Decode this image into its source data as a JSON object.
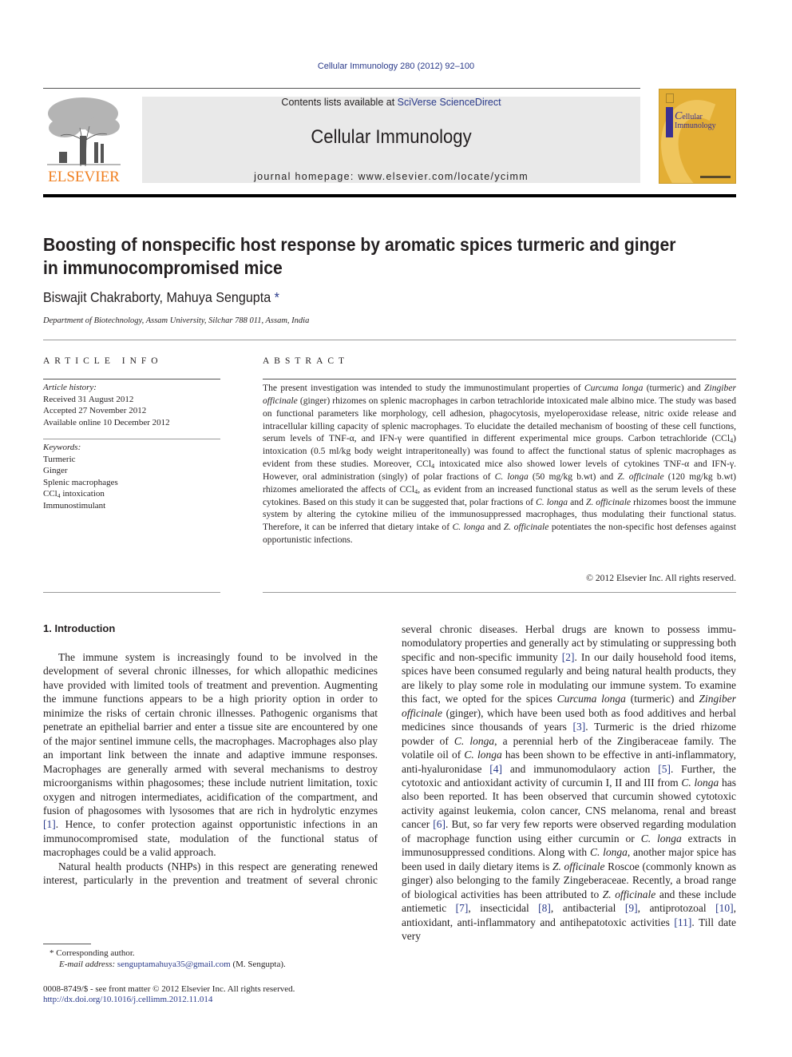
{
  "running_head": "Cellular Immunology 280 (2012) 92–100",
  "masthead": {
    "publisher_logo_text": "ELSEVIER",
    "contents_prefix": "Contents lists available at ",
    "contents_link": "SciVerse ScienceDirect",
    "journal_title": "Cellular Immunology",
    "homepage": "journal homepage: www.elsevier.com/locate/ycimm",
    "cover_title_line1": "ellular",
    "cover_title_line2": "Immunology",
    "cover_initial": "C"
  },
  "colors": {
    "link": "#2a3a8a",
    "elsevier_orange": "#f07f1f",
    "cover_gold": "#e3ae34",
    "banner_gray": "#e9e9e9"
  },
  "article": {
    "title_line1": "Boosting of nonspecific host response by aromatic spices turmeric and ginger",
    "title_line2": "in immunocompromised mice",
    "authors": "Biswajit Chakraborty, Mahuya Sengupta",
    "author_mark": "*",
    "affiliation": "Department of Biotechnology, Assam University, Silchar 788 011, Assam, India"
  },
  "article_info": {
    "heading": "ARTICLE INFO",
    "history_label": "Article history:",
    "history": [
      "Received 31 August 2012",
      "Accepted 27 November 2012",
      "Available online 10 December 2012"
    ],
    "keywords_label": "Keywords:",
    "keywords": [
      "Turmeric",
      "Ginger",
      "Splenic macrophages",
      "CCl4 intoxication",
      "Immunostimulant"
    ]
  },
  "abstract": {
    "heading": "ABSTRACT",
    "s1a": "The present investigation was intended to study the immunostimulant properties of ",
    "curcuma": "Curcuma longa",
    "s1b": " (turmeric) and ",
    "zingiber": "Zingiber officinale",
    "s1c": " (ginger) rhizomes on splenic macrophages in carbon tetrachloride intox­icated male albino mice. The study was based on functional parameters like morphology, cell adhesion, phagocytosis, myeloperoxidase release, nitric oxide release and intracellular killing capacity of splenic macrophages. To elucidate the detailed mechanism of boosting of these cell functions, serum levels of TNF-α, and IFN-γ were quantified in different experimental mice groups. Carbon tetrachloride (CCl",
    "s2": ") intoxication (0.5 ml/kg body weight intraperitoneally) was found to affect the functional status of splenic macrophages as evident from these studies. Moreover, CCl",
    "s3": " intoxicated mice also showed lower levels of cytokines TNF-α and IFN-γ. However, oral administration (singly) of polar fractions of ",
    "c_longa": "C. longa",
    "s4": " (50 mg/kg b.wt) and ",
    "z_off": "Z. officinale",
    "s5": " (120 mg/kg b.wt) rhizomes ameliorated the affects of CCl",
    "s6": ", as evident from an increased functional status as well as the serum levels of these cytokines. Based on this study it can be suggested that, polar fractions of ",
    "s7": " and ",
    "s8": " rhizomes boost the immune system by altering the cytokine milieu of the immunosuppressed macrophages, thus modulating their functional status. Therefore, it can be inferred that dietary intake of ",
    "s9": " potentiates the non-specific host defenses against opportunistic infections.",
    "sub4": "4",
    "copyright": "© 2012 Elsevier Inc. All rights reserved."
  },
  "introduction": {
    "heading": "1. Introduction",
    "p1a": "The immune system is increasingly found to be involved in the development of several chronic illnesses, for which allopathic medicines have provided with limited tools of treatment and pre­vention. Augmenting the immune functions appears to be a high priority option in order to minimize the risks of certain chronic ill­nesses. Pathogenic organisms that penetrate an epithelial barrier and enter a tissue site are encountered by one of the major sentinel immune cells, the macrophages. Macrophages also play an impor­tant link between the innate and adaptive immune responses. Macrophages are generally armed with several mechanisms to de­stroy microorganisms within phagosomes; these include nutrient limitation, toxic oxygen and nitrogen intermediates, acidification of the compartment, and fusion of phagosomes with lysosomes that are rich in hydrolytic enzymes ",
    "ref1": "[1]",
    "p1b": ". Hence, to confer protection against opportunistic infections in an immunocompromised state, modulation of the functional status of macrophages could be a va­lid approach.",
    "p2a": "Natural health products (NHPs) in this respect are generating renewed interest, particularly in the prevention and treatment of several chronic diseases. Herbal drugs are known to possess immu­nomodulatory properties and generally act by stimulating or sup­pressing both specific and non-specific immunity ",
    "ref2": "[2]",
    "p2b": ". In our daily household food items, spices have been consumed regularly and being natural health products, they are likely to play some role in modulating our immune system. To examine this fact, we opted for the spices ",
    "p2c": " (turmeric) and ",
    "p2d": " (gin­ger), which have been used both as food additives and herbal med­icines since thousands of years ",
    "ref3": "[3]",
    "p2e": ". Turmeric is the dried rhizome powder of ",
    "p2f": ", a perennial herb of the Zingiberaceae family. The volatile oil of ",
    "p2g": " has been shown to be effective in anti-inflammatory, anti-hyaluronidase ",
    "ref4": "[4]",
    "p2h": " and immunomodulaory ac­tion ",
    "ref5": "[5]",
    "p2i": ". Further, the cytotoxic and antioxidant activity of curcumin I, II and III from ",
    "p2j": " has also been reported. It has been ob­served that curcumin showed cytotoxic activity against leukemia, colon cancer, CNS melanoma, renal and breast cancer ",
    "ref6": "[6]",
    "p2k": ". But, so far very few reports were observed regarding modulation of mac­rophage function using either curcumin or ",
    "p2l": " extracts in immunosuppressed conditions. Along with ",
    "p2m": ", another major spice has been used in daily dietary items is ",
    "p2n": " Roscoe (commonly known as ginger) also belonging to the family Zinge­beraceae. Recently, a broad range of biological activities has been attributed to ",
    "p2o": " and these include antiemetic ",
    "ref7": "[7]",
    "p2p": ", insecti­cidal ",
    "ref8": "[8]",
    "p2q": ", antibacterial ",
    "ref9": "[9]",
    "p2r": ", antiprotozoal ",
    "ref10": "[10]",
    "p2s": ", antioxidant, anti-inflammatory and antihepatotoxic activities ",
    "ref11": "[11]",
    "p2t": ". Till date very"
  },
  "footnotes": {
    "corresponding": "* Corresponding author.",
    "email_label": "E-mail address: ",
    "email": "senguptamahuya35@gmail.com",
    "email_suffix": " (M. Sengupta).",
    "front_matter": "0008-8749/$ - see front matter © 2012 Elsevier Inc. All rights reserved.",
    "doi": "http://dx.doi.org/10.1016/j.cellimm.2012.11.014"
  }
}
